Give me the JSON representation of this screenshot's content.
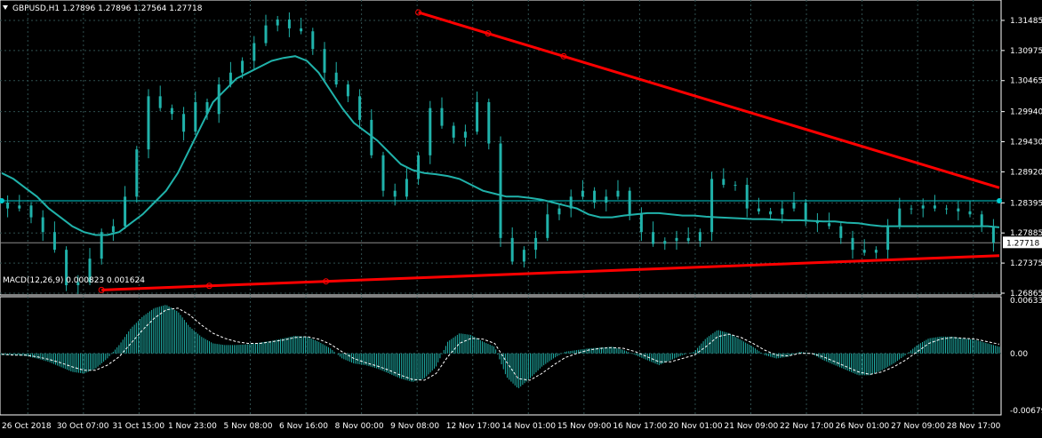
{
  "symbol_header": "GBPUSD,H1  1.27896 1.27896 1.27564 1.27718",
  "macd_header": "MACD(12,26,9) 0.000823 0.001624",
  "current_price_label": "1.27718",
  "colors": {
    "background": "#000000",
    "grid": "#2f4f4f",
    "candle": "#20b2aa",
    "moving_average": "#20b2aa",
    "trendline": "#ff0000",
    "horizontal_line": "#00ced1",
    "macd_histogram": "#20b2aa",
    "macd_signal": "#ffffff"
  },
  "chart_data": [
    {
      "type": "line",
      "name": "price",
      "yticks": [
        "1.31485",
        "1.30975",
        "1.30465",
        "1.29940",
        "1.29430",
        "1.28920",
        "1.28395",
        "1.27885",
        "1.27375",
        "1.26865"
      ],
      "ylim": [
        1.26865,
        1.3174
      ],
      "xticks": [
        "26 Oct 2018",
        "30 Oct 07:00",
        "31 Oct 15:00",
        "1 Nov 23:00",
        "5 Nov 08:00",
        "6 Nov 16:00",
        "8 Nov 00:00",
        "9 Nov 08:00",
        "12 Nov 17:00",
        "14 Nov 01:00",
        "15 Nov 09:00",
        "16 Nov 17:00",
        "20 Nov 01:00",
        "21 Nov 09:00",
        "22 Nov 17:00",
        "26 Nov 01:00",
        "27 Nov 09:00",
        "28 Nov 17:00"
      ],
      "x": [
        0,
        2,
        4,
        6,
        8,
        10,
        12,
        14,
        16,
        18,
        20,
        22,
        24,
        26,
        28,
        30,
        32,
        34,
        36,
        38,
        40,
        42,
        44,
        46,
        48,
        50,
        52,
        54,
        56,
        58,
        60,
        62,
        64,
        66,
        68,
        70,
        72,
        74,
        76,
        78,
        80,
        82,
        84,
        86,
        88,
        90,
        92,
        94,
        96,
        98,
        100,
        102,
        104,
        106,
        108,
        110,
        112,
        114,
        116,
        118,
        120,
        122,
        124,
        126,
        128,
        130,
        132,
        134,
        136,
        138,
        140,
        142,
        144,
        146,
        148,
        150,
        152,
        154,
        156,
        158,
        160,
        162,
        164,
        166,
        168,
        170
      ],
      "close": [
        1.284,
        1.283,
        1.2835,
        1.2815,
        1.279,
        1.276,
        1.27,
        1.2705,
        1.2745,
        1.279,
        1.28,
        1.285,
        1.293,
        1.302,
        1.3,
        1.299,
        1.296,
        1.301,
        1.299,
        1.304,
        1.306,
        1.308,
        1.311,
        1.314,
        1.315,
        1.3135,
        1.313,
        1.31,
        1.306,
        1.304,
        1.302,
        1.298,
        1.292,
        1.286,
        1.285,
        1.288,
        1.292,
        1.3,
        1.297,
        1.295,
        1.296,
        1.301,
        1.294,
        1.278,
        1.274,
        1.276,
        1.278,
        1.282,
        1.283,
        1.285,
        1.286,
        1.284,
        1.285,
        1.286,
        1.282,
        1.279,
        1.277,
        1.2775,
        1.278,
        1.2775,
        1.279,
        1.288,
        1.287,
        1.287,
        1.283,
        1.2825,
        1.282,
        1.283,
        1.284,
        1.281,
        1.2805,
        1.28,
        1.278,
        1.276,
        1.2755,
        1.276,
        1.28,
        1.283,
        1.283,
        1.2835,
        1.283,
        1.283,
        1.2825,
        1.282,
        1.28,
        1.2772
      ],
      "ma": [
        1.289,
        1.288,
        1.2865,
        1.285,
        1.283,
        1.2815,
        1.28,
        1.279,
        1.2785,
        1.2785,
        1.279,
        1.2805,
        1.282,
        1.284,
        1.286,
        1.289,
        1.293,
        1.297,
        1.301,
        1.303,
        1.305,
        1.306,
        1.307,
        1.308,
        1.3085,
        1.3088,
        1.308,
        1.306,
        1.303,
        1.3,
        1.2975,
        1.296,
        1.2945,
        1.2925,
        1.2905,
        1.2895,
        1.289,
        1.2888,
        1.2885,
        1.288,
        1.287,
        1.286,
        1.2855,
        1.285,
        1.285,
        1.2848,
        1.2845,
        1.284,
        1.2835,
        1.283,
        1.282,
        1.2815,
        1.2815,
        1.2818,
        1.282,
        1.2822,
        1.2822,
        1.282,
        1.2818,
        1.2818,
        1.2816,
        1.2815,
        1.2814,
        1.2813,
        1.2812,
        1.2812,
        1.2811,
        1.281,
        1.281,
        1.2809,
        1.2808,
        1.2808,
        1.2806,
        1.2805,
        1.2802,
        1.28,
        1.28,
        1.28,
        1.28,
        1.28,
        1.28,
        1.28,
        1.28,
        1.28,
        1.28,
        1.2798
      ],
      "horizontal_lines": [
        1.2843,
        1.27718
      ],
      "trendlines": [
        {
          "x": [
            71,
            170
          ],
          "y": [
            1.3162,
            1.2865
          ]
        },
        {
          "x": [
            17,
            170
          ],
          "y": [
            1.2692,
            1.275
          ]
        }
      ]
    },
    {
      "type": "bar",
      "name": "macd",
      "yticks": [
        "0.006332",
        "0.00",
        "-0.006798"
      ],
      "ylim": [
        -0.006798,
        0.006332
      ],
      "x": [
        0,
        2,
        4,
        6,
        8,
        10,
        12,
        14,
        16,
        18,
        20,
        22,
        24,
        26,
        28,
        30,
        32,
        34,
        36,
        38,
        40,
        42,
        44,
        46,
        48,
        50,
        52,
        54,
        56,
        58,
        60,
        62,
        64,
        66,
        68,
        70,
        72,
        74,
        76,
        78,
        80,
        82,
        84,
        86,
        88,
        90,
        92,
        94,
        96,
        98,
        100,
        102,
        104,
        106,
        108,
        110,
        112,
        114,
        116,
        118,
        120,
        122,
        124,
        126,
        128,
        130,
        132,
        134,
        136,
        138,
        140,
        142,
        144,
        146,
        148,
        150,
        152,
        154,
        156,
        158,
        160,
        162,
        164,
        166,
        168,
        170
      ],
      "histogram": [
        -0.0002,
        -0.0002,
        -0.0003,
        -0.0006,
        -0.001,
        -0.0016,
        -0.0022,
        -0.0024,
        -0.0018,
        -0.0006,
        0.001,
        0.003,
        0.0044,
        0.0054,
        0.0058,
        0.005,
        0.0032,
        0.002,
        0.0012,
        0.001,
        0.001,
        0.0011,
        0.0013,
        0.0015,
        0.0018,
        0.0021,
        0.002,
        0.0014,
        0.0006,
        -0.0006,
        -0.0012,
        -0.0014,
        -0.0018,
        -0.0024,
        -0.003,
        -0.0034,
        -0.003,
        -0.0016,
        0.0014,
        0.0024,
        0.0022,
        0.0014,
        0.0008,
        -0.0028,
        -0.0042,
        -0.003,
        -0.0016,
        -0.0006,
        0.0002,
        0.0004,
        0.0006,
        0.0007,
        0.0008,
        0.0004,
        -0.0002,
        -0.0008,
        -0.0014,
        -0.0008,
        -0.0002,
        0.0002,
        0.0018,
        0.0028,
        0.0024,
        0.0016,
        0.0008,
        -0.0002,
        -0.0006,
        -0.0004,
        0.0002,
        0.0,
        -0.0008,
        -0.0014,
        -0.002,
        -0.0026,
        -0.0026,
        -0.002,
        -0.0012,
        -0.0002,
        0.001,
        0.0018,
        0.002,
        0.002,
        0.0018,
        0.0016,
        0.0012,
        0.0008
      ],
      "signal": [
        -0.0001,
        -0.0002,
        -0.0002,
        -0.0004,
        -0.0007,
        -0.0011,
        -0.0016,
        -0.002,
        -0.002,
        -0.0014,
        -0.0004,
        0.0012,
        0.0028,
        0.0042,
        0.0052,
        0.0054,
        0.0046,
        0.0034,
        0.0024,
        0.0018,
        0.0014,
        0.0012,
        0.0012,
        0.0014,
        0.0016,
        0.0019,
        0.002,
        0.0017,
        0.0011,
        0.0002,
        -0.0006,
        -0.0011,
        -0.0015,
        -0.002,
        -0.0026,
        -0.0031,
        -0.0032,
        -0.0024,
        -0.0004,
        0.0012,
        0.0018,
        0.0017,
        0.0012,
        -0.001,
        -0.003,
        -0.0032,
        -0.0024,
        -0.0014,
        -0.0005,
        0.0,
        0.0004,
        0.0006,
        0.0007,
        0.0006,
        0.0002,
        -0.0004,
        -0.001,
        -0.001,
        -0.0006,
        -0.0002,
        0.0008,
        0.002,
        0.0023,
        0.0019,
        0.0012,
        0.0004,
        -0.0002,
        -0.0003,
        0.0,
        0.0,
        -0.0004,
        -0.001,
        -0.0016,
        -0.0022,
        -0.0025,
        -0.0022,
        -0.0016,
        -0.0008,
        0.0002,
        0.0012,
        0.0017,
        0.0019,
        0.0018,
        0.0017,
        0.0014,
        0.0011
      ]
    }
  ]
}
